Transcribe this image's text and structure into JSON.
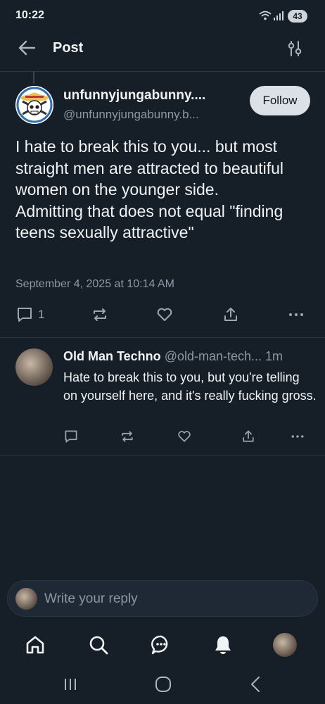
{
  "status_bar": {
    "time": "10:22",
    "battery": "43"
  },
  "header": {
    "title": "Post"
  },
  "post": {
    "author_name": "unfunnyjungabunny....",
    "author_handle": "@unfunnyjungabunny.b...",
    "follow_label": "Follow",
    "text": "I hate to break this to you... but most straight men are attracted to beautiful women on the younger side.\nAdmitting that does not equal \"finding teens sexually attractive\"",
    "timestamp": "September 4, 2025 at 10:14 AM",
    "reply_count": "1"
  },
  "reply": {
    "author_name": "Old Man Techno",
    "author_handle": "@old-man-tech...",
    "time": "1m",
    "text": "Hate to break this to you, but you're telling on yourself here, and it's really fucking gross."
  },
  "composer": {
    "placeholder": "Write your reply"
  },
  "colors": {
    "background": "#161e27",
    "muted": "#8b98a5",
    "divider": "#2a3541",
    "follow_bg": "#dbe1e7"
  }
}
